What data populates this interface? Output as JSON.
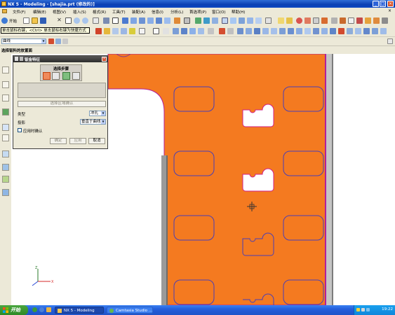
{
  "window": {
    "title": "NX 5 - Modeling - [shajia.prt  (修改的)]",
    "minimize_glyph": "_",
    "restore_glyph": "□",
    "close_glyph": "×",
    "doc_close_glyph": "×"
  },
  "menubar": {
    "start_label": "开始",
    "items": [
      "文件(F)",
      "编辑(E)",
      "视图(V)",
      "插入(S)",
      "格式(R)",
      "工具(T)",
      "装配(A)",
      "信息(I)",
      "分析(L)",
      "首选项(P)",
      "窗口(O)",
      "帮助(H)"
    ]
  },
  "hint": {
    "text": "单击鼠标右键，<Ctrl> 单击鼠标右键为快捷方式"
  },
  "filter": {
    "value": "曲线",
    "arrow": "▼"
  },
  "status": {
    "prompt": "选择钣料的放置面"
  },
  "dialog": {
    "title": "钣金特征",
    "close_glyph": "×",
    "step_group_label": "选择步骤",
    "select_region_button": "选择区域确认",
    "type_label": "类型",
    "type_value": "冲孔",
    "projection_label": "投影",
    "projection_value": "垂直于曲线",
    "confirm_checkbox_label": "应用时确认",
    "ok_button": "确定",
    "apply_button": "应用",
    "cancel_button": "取消",
    "combo_arrow": "▼"
  },
  "taskbar": {
    "start_label": "开始",
    "tasks": [
      "NX 5 - Modeling",
      "Camtasia Studio ..."
    ],
    "clock": "19:22"
  },
  "viewport": {
    "axis_label_z": "Z",
    "axis_label_x": "X",
    "sheet_color": "#f47a20",
    "cutout_color": "#4a3fb6"
  },
  "colors": {
    "title_bar": "#0a3fb3",
    "dialog_title": "#2d2d2d",
    "start_button": "#2e8a26",
    "taskbar": "#245edb"
  }
}
